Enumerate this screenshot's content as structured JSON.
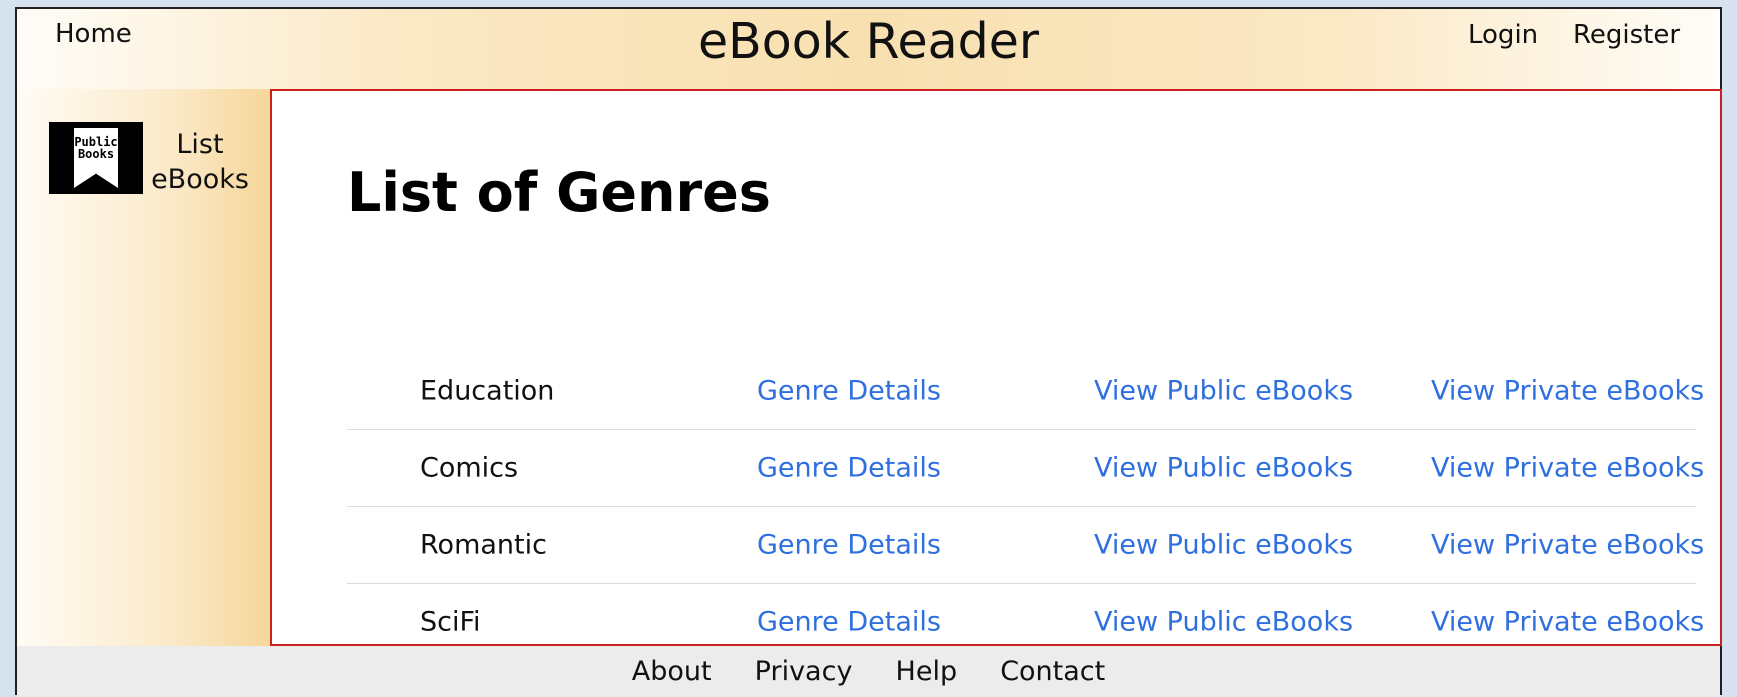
{
  "header": {
    "home": "Home",
    "title": "eBook Reader",
    "login": "Login",
    "register": "Register"
  },
  "sidebar": {
    "logo_text_line1": "Public",
    "logo_text_line2": "Books",
    "link_line1": "List",
    "link_line2": "eBooks"
  },
  "main": {
    "title": "List of Genres",
    "rows": [
      {
        "name": "Education",
        "details": "Genre Details",
        "public": "View Public eBooks",
        "private": "View Private eBooks"
      },
      {
        "name": "Comics",
        "details": "Genre Details",
        "public": "View Public eBooks",
        "private": "View Private eBooks"
      },
      {
        "name": "Romantic",
        "details": "Genre Details",
        "public": "View Public eBooks",
        "private": "View Private eBooks"
      },
      {
        "name": "SciFi",
        "details": "Genre Details",
        "public": "View Public eBooks",
        "private": "View Private eBooks"
      }
    ]
  },
  "footer": {
    "about": "About",
    "privacy": "Privacy",
    "help": "Help",
    "contact": "Contact"
  }
}
